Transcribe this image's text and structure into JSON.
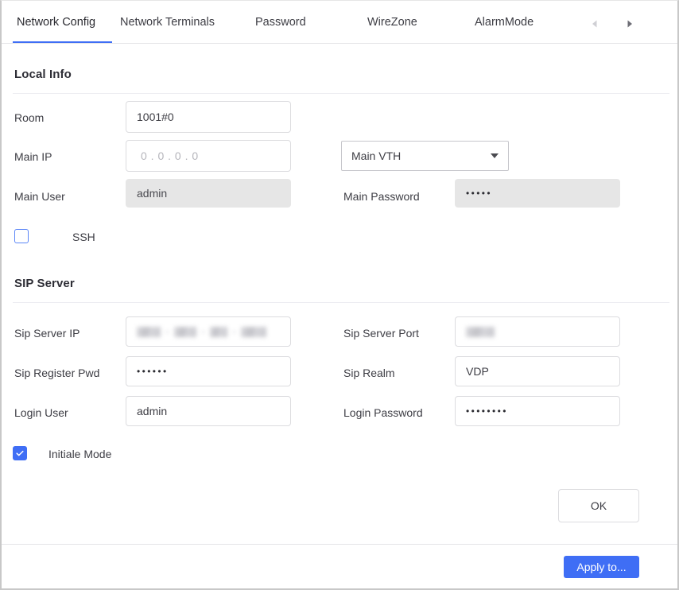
{
  "tabs": {
    "items": [
      {
        "label": "Network Config",
        "active": true
      },
      {
        "label": "Network Terminals",
        "active": false
      },
      {
        "label": "Password",
        "active": false
      },
      {
        "label": "WireZone",
        "active": false
      },
      {
        "label": "AlarmMode",
        "active": false
      }
    ],
    "prev_icon": "triangle-left-icon",
    "next_icon": "triangle-right-icon"
  },
  "local_info": {
    "title": "Local Info",
    "room": {
      "label": "Room",
      "value": "1001#0"
    },
    "main_ip": {
      "label": "Main IP",
      "value": "0 . 0 . 0 . 0",
      "is_placeholder": true
    },
    "device_type": {
      "value": "Main VTH"
    },
    "main_user": {
      "label": "Main User",
      "value": "admin",
      "disabled": true
    },
    "main_password": {
      "label": "Main Password",
      "value": "•••••",
      "disabled": true,
      "masked_length": 5
    },
    "ssh": {
      "label": "SSH",
      "checked": false
    }
  },
  "sip_server": {
    "title": "SIP Server",
    "sip_server_ip": {
      "label": "Sip Server IP",
      "value": "",
      "redacted": true
    },
    "sip_server_port": {
      "label": "Sip Server Port",
      "value": "",
      "redacted": true
    },
    "sip_register_pwd": {
      "label": "Sip Register Pwd",
      "value": "••••••",
      "masked_length": 6
    },
    "sip_realm": {
      "label": "Sip Realm",
      "value": "VDP"
    },
    "login_user": {
      "label": "Login User",
      "value": "admin"
    },
    "login_password": {
      "label": "Login Password",
      "value": "••••••••",
      "masked_length": 8
    },
    "initiale_mode": {
      "label": "Initiale Mode",
      "checked": true
    }
  },
  "actions": {
    "ok_label": "OK",
    "apply_label": "Apply to..."
  },
  "colors": {
    "accent": "#3f6ef5",
    "text": "#3d3d44",
    "border": "#dcdcdf",
    "disabled_bg": "#e6e6e6"
  }
}
